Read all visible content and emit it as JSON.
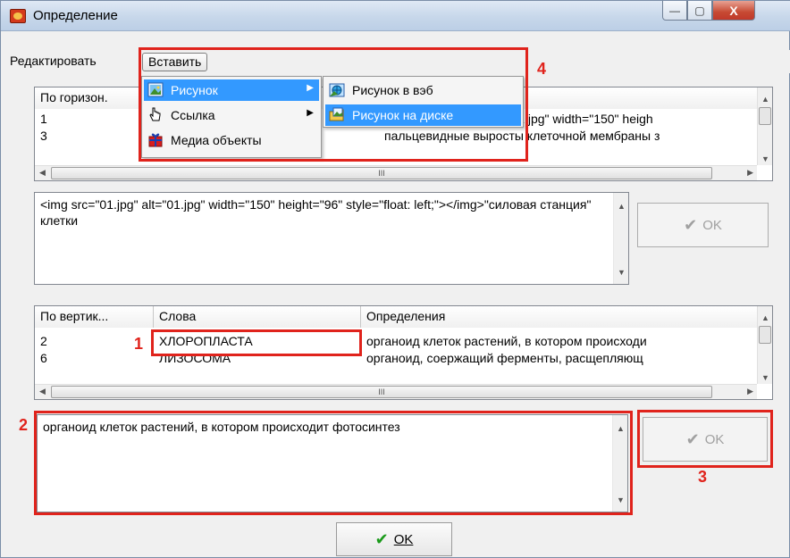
{
  "window": {
    "title": "Определение",
    "close_glyph": "X",
    "min_glyph": "—",
    "max_glyph": "▢"
  },
  "menubar": {
    "items": [
      "Редактировать",
      "Вставить"
    ]
  },
  "insert_menu": {
    "items": [
      {
        "label": "Рисунок",
        "icon": "picture-icon",
        "has_submenu": true
      },
      {
        "label": "Ссылка",
        "icon": "hand-link-icon",
        "has_submenu": true
      },
      {
        "label": "Медиа объекты",
        "icon": "gift-icon",
        "has_submenu": false
      }
    ]
  },
  "picture_submenu": {
    "items": [
      {
        "label": "Рисунок в вэб",
        "icon": "web-picture-icon"
      },
      {
        "label": "Рисунок на диске",
        "icon": "folder-picture-icon"
      }
    ]
  },
  "top_grid": {
    "columns": [
      "По горизон.",
      "",
      ""
    ],
    "rows": [
      {
        "num": "1",
        "word": "",
        "definition": "<img src=\"01.jpg\" alt=\"01.jpg\" width=\"150\" heigh"
      },
      {
        "num": "3",
        "word": "",
        "definition": "пальцевидные выросты клеточной мембраны з"
      }
    ],
    "hscroll_marker": "III"
  },
  "top_memo": {
    "text": "<img src=\"01.jpg\" alt=\"01.jpg\" width=\"150\" height=\"96\" style=\"float: left;\"></img>\"силовая станция\" клетки"
  },
  "top_ok": {
    "label": "OK",
    "icon": "check-icon"
  },
  "bottom_grid": {
    "columns": [
      "По вертик...",
      "Слова",
      "Определения"
    ],
    "rows": [
      {
        "num": "2",
        "word": "ХЛОРОПЛАСТА",
        "definition": "органоид клеток растений, в котором происходи"
      },
      {
        "num": "6",
        "word": "ЛИЗОСОМА",
        "definition": "органоид, соержащий ферменты, расщепляющ"
      }
    ],
    "hscroll_marker": "III"
  },
  "bottom_memo": {
    "text": "органоид клеток растений, в котором происходит фотосинтез"
  },
  "bottom_ok": {
    "label": "OK",
    "icon": "check-icon"
  },
  "main_ok": {
    "label": "OK",
    "icon": "check-icon"
  },
  "annotations": {
    "n1": "1",
    "n2": "2",
    "n3": "3",
    "n4": "4",
    "color": "#e0231c"
  },
  "colors": {
    "highlight": "#3399ff",
    "check_green": "#1a9a1a",
    "annotation_red": "#e0231c"
  }
}
